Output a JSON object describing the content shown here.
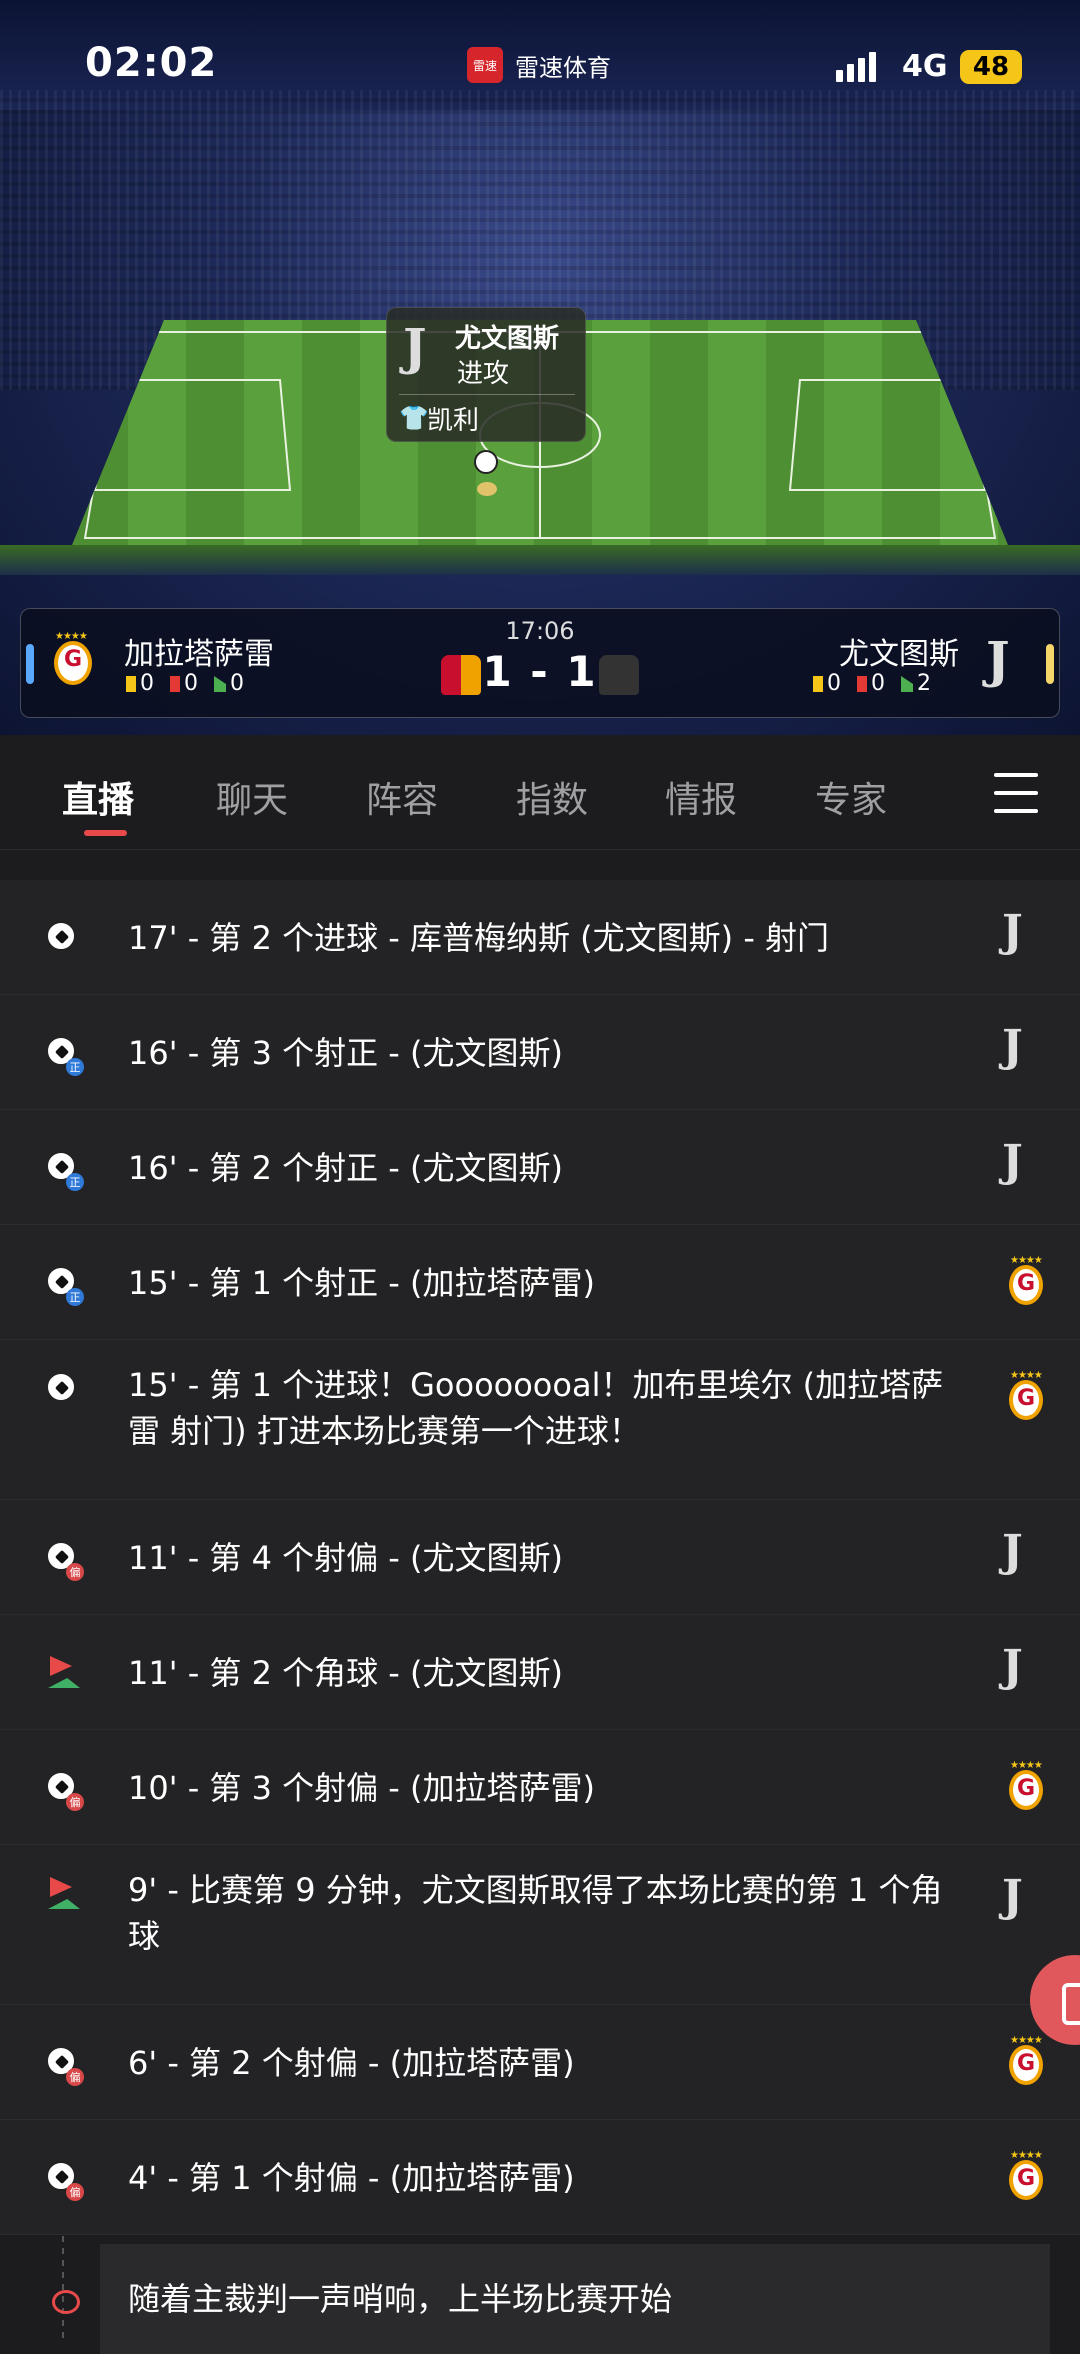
{
  "status_bar": {
    "time": "02:02",
    "network": "4G",
    "battery": "48"
  },
  "app": {
    "name": "雷速体育",
    "logo_text": "雷速"
  },
  "event_tooltip": {
    "team": "尤文图斯",
    "action": "进攻",
    "player": "凯利"
  },
  "scoreboard": {
    "match_time": "17:06",
    "score": "1 - 1",
    "home": {
      "name": "加拉塔萨雷",
      "yellow": "0",
      "red": "0",
      "corners": "0"
    },
    "away": {
      "name": "尤文图斯",
      "yellow": "0",
      "red": "0",
      "corners": "2"
    }
  },
  "tabs": [
    {
      "label": "直播",
      "active": true
    },
    {
      "label": "聊天"
    },
    {
      "label": "阵容"
    },
    {
      "label": "指数"
    },
    {
      "label": "情报"
    },
    {
      "label": "专家"
    }
  ],
  "events": [
    {
      "text": "17' - 第 2 个进球 - 库普梅纳斯 (尤文图斯) - 射门",
      "icon": "goal",
      "team": "away"
    },
    {
      "text": "16' - 第 3 个射正 - (尤文图斯)",
      "icon": "shot-on",
      "team": "away"
    },
    {
      "text": "16' - 第 2 个射正 - (尤文图斯)",
      "icon": "shot-on",
      "team": "away"
    },
    {
      "text": "15' - 第 1 个射正 - (加拉塔萨雷)",
      "icon": "shot-on",
      "team": "home"
    },
    {
      "text": "15' - 第 1 个进球！Goooooooal！加布里埃尔 (加拉塔萨雷 射门) 打进本场比赛第一个进球！",
      "icon": "goal",
      "team": "home"
    },
    {
      "text": "11' - 第 4 个射偏 - (尤文图斯)",
      "icon": "shot-off",
      "team": "away"
    },
    {
      "text": "11' - 第 2 个角球 - (尤文图斯)",
      "icon": "corner",
      "team": "away"
    },
    {
      "text": "10' - 第 3 个射偏 - (加拉塔萨雷)",
      "icon": "shot-off",
      "team": "home"
    },
    {
      "text": "9' - 比赛第 9 分钟，尤文图斯取得了本场比赛的第 1 个角球",
      "icon": "corner",
      "team": "away"
    },
    {
      "text": "6' - 第 2 个射偏 - (加拉塔萨雷)",
      "icon": "shot-off",
      "team": "home"
    },
    {
      "text": "4' - 第 1 个射偏 - (加拉塔萨雷)",
      "icon": "shot-off",
      "team": "home"
    },
    {
      "text": "随着主裁判一声哨响，上半场比赛开始",
      "icon": "whistle",
      "team": ""
    }
  ],
  "badges": {
    "shot_on": "正",
    "shot_off": "偏"
  },
  "colors": {
    "accent": "#e84a4a",
    "background": "#1c1c1e",
    "row": "#232325"
  }
}
